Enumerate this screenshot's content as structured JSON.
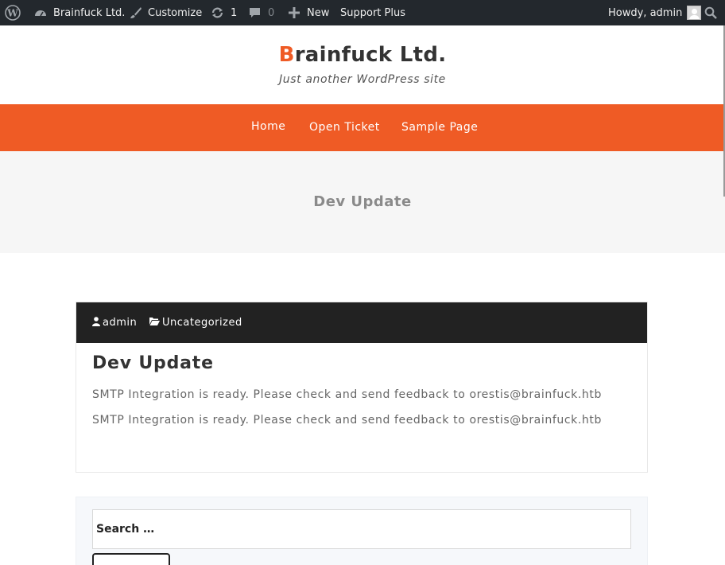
{
  "admin_bar": {
    "site_name": "Brainfuck Ltd.",
    "customize": "Customize",
    "updates_count": "1",
    "comments_count": "0",
    "new_label": "New",
    "plugin_label": "Support Plus",
    "greeting": "Howdy, admin",
    "bg_color": "#23282d"
  },
  "header": {
    "title_first_letter": "B",
    "title_rest": "rainfuck Ltd.",
    "tagline": "Just another WordPress site",
    "accent_color": "#ef5b25"
  },
  "nav": {
    "items": [
      {
        "label": "Home"
      },
      {
        "label": "Open Ticket"
      },
      {
        "label": "Sample Page"
      }
    ]
  },
  "banner": {
    "title": "Dev Update"
  },
  "post": {
    "author": "admin",
    "category": "Uncategorized",
    "title": "Dev Update",
    "paragraphs": [
      "SMTP Integration is ready. Please check and send feedback to orestis@brainfuck.htb",
      "SMTP Integration is ready. Please check and send feedback to orestis@brainfuck.htb"
    ]
  },
  "search": {
    "placeholder": "Search …"
  }
}
